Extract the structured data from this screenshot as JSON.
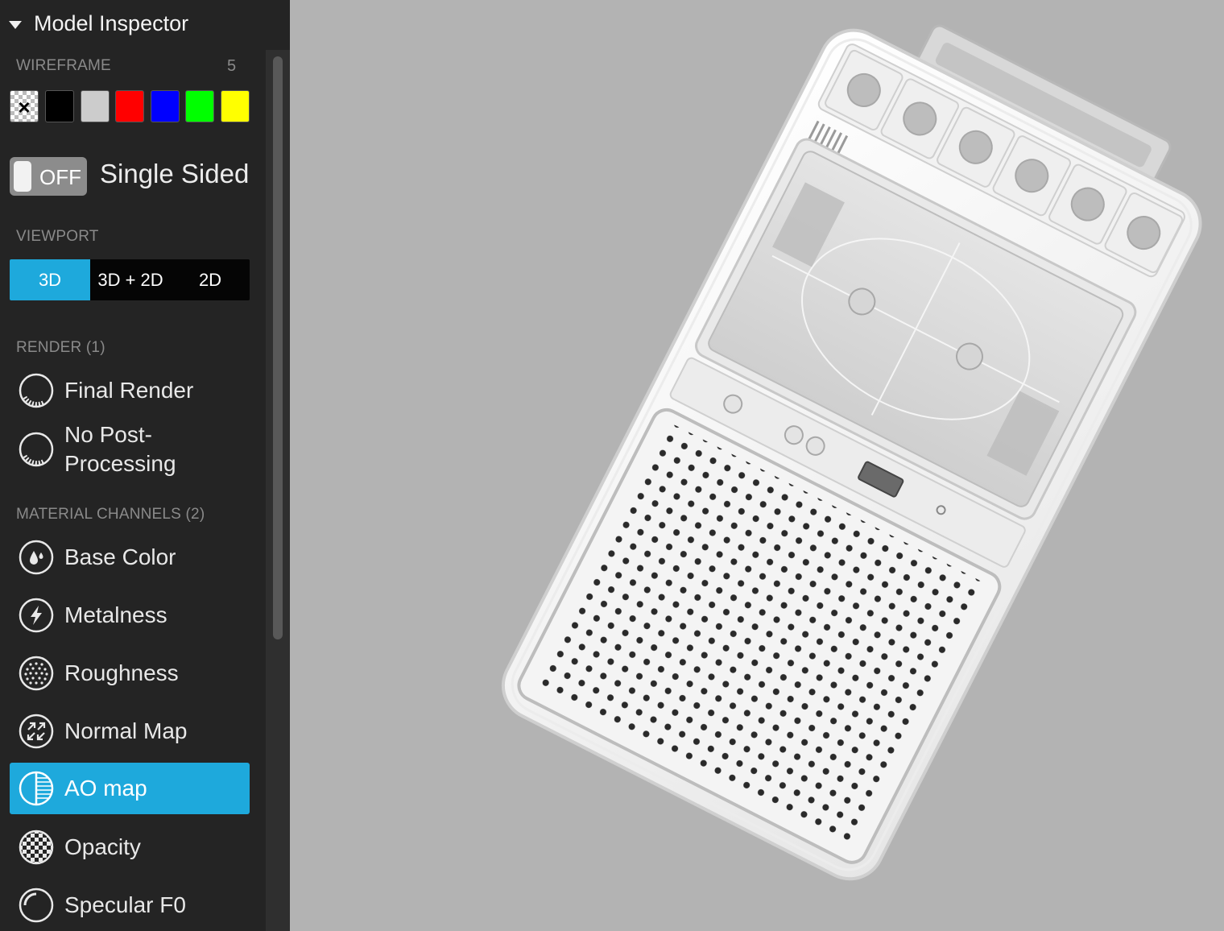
{
  "panel": {
    "title": "Model Inspector"
  },
  "wireframe": {
    "label": "WIREFRAME",
    "count": "5",
    "none_mark": "×",
    "colors": [
      "#000000",
      "#cccccc",
      "#ff0000",
      "#0000ff",
      "#00ff00",
      "#ffff00"
    ]
  },
  "single_sided": {
    "state": "OFF",
    "label": "Single Sided"
  },
  "viewport": {
    "label": "VIEWPORT",
    "options": [
      "3D",
      "3D + 2D",
      "2D"
    ],
    "selected": "3D"
  },
  "render": {
    "label": "RENDER (1)",
    "items": [
      "Final Render",
      "No Post-Processing"
    ]
  },
  "material_channels": {
    "label": "MATERIAL CHANNELS (2)",
    "items": [
      "Base Color",
      "Metalness",
      "Roughness",
      "Normal Map",
      "AO map",
      "Opacity",
      "Specular F0"
    ],
    "selected": "AO map"
  },
  "colors": {
    "accent": "#1ea9dc",
    "sidebar_bg": "#242424",
    "viewer_bg": "#b3b3b3"
  }
}
